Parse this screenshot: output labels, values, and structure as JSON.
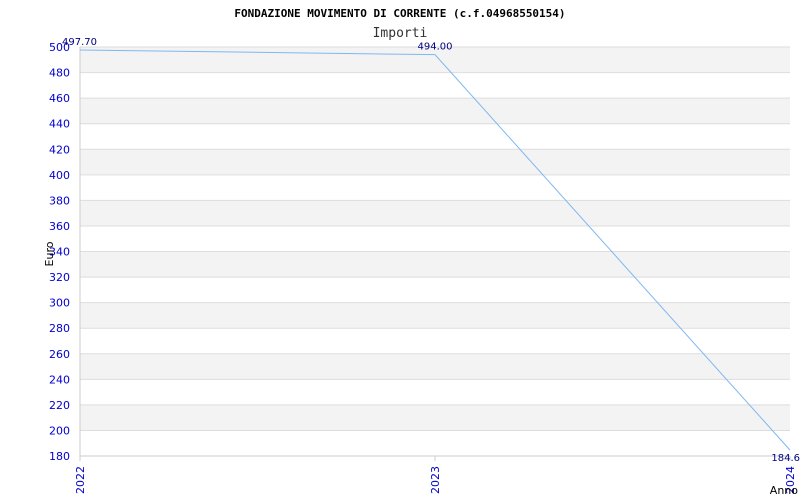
{
  "chart_data": {
    "type": "line",
    "title": "FONDAZIONE MOVIMENTO DI CORRENTE (c.f.04968550154)",
    "subtitle": "Importi",
    "xlabel": "Anno",
    "ylabel": "Euro",
    "categories": [
      "2022",
      "2023",
      "2024"
    ],
    "series": [
      {
        "values": [
          497.7,
          494.0,
          184.6
        ],
        "labels": [
          "497.70",
          "494.00",
          "184.6"
        ]
      }
    ],
    "ylim": [
      180,
      500
    ],
    "yticks": [
      "180",
      "200",
      "220",
      "240",
      "260",
      "280",
      "300",
      "320",
      "340",
      "360",
      "380",
      "400",
      "420",
      "440",
      "460",
      "480",
      "500"
    ],
    "grid": true,
    "band_colors": [
      "#f3f3f3",
      "#ffffff"
    ],
    "line_color": "#7fb8f0",
    "tick_color": "#0000cc"
  }
}
